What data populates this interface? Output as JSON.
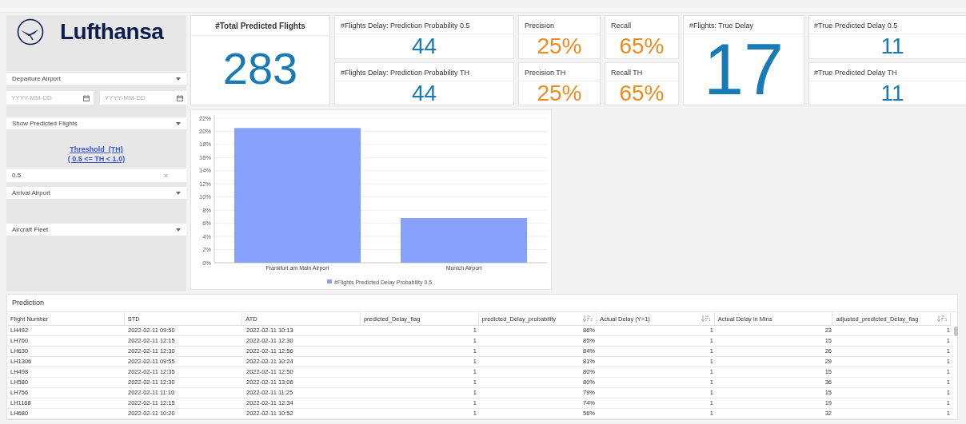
{
  "logo": {
    "text": "Lufthansa"
  },
  "filters": [
    {
      "kind": "dropdown",
      "label": "Departure Airport"
    },
    {
      "kind": "dates",
      "placeholders": [
        "YYYY-MM-DD",
        "YYYY-MM-DD"
      ]
    },
    {
      "kind": "dropdown",
      "label": "Show Predicted Flights"
    },
    {
      "kind": "link",
      "lines": [
        "Threshold  (TH)",
        "( 0.5 <= TH < 1.0)"
      ]
    },
    {
      "kind": "input",
      "value": "0.5",
      "clear_icon": "×"
    },
    {
      "kind": "dropdown",
      "label": "Arrival Airport"
    },
    {
      "kind": "dropdown",
      "label": "Aircraft Fleet"
    }
  ],
  "total": {
    "title": "#Total Predicted Flights",
    "value": "283"
  },
  "metric_columns": [
    [
      {
        "title": "#Flights Delay: Prediction Probability 0.5",
        "value": "44",
        "kind": "count"
      },
      {
        "title": "#Flights Delay: Prediction Probability TH",
        "value": "44",
        "kind": "count"
      }
    ],
    [
      {
        "title": "Precision",
        "value": "25%",
        "kind": "rate"
      },
      {
        "title": "Precision TH",
        "value": "25%",
        "kind": "rate"
      }
    ],
    [
      {
        "title": "Recall",
        "value": "65%",
        "kind": "rate"
      },
      {
        "title": "Recall TH",
        "value": "65%",
        "kind": "rate"
      }
    ],
    [
      {
        "title": "#Flights: True Delay",
        "value": "17",
        "kind": "big"
      }
    ],
    [
      {
        "title": "#True Predicted Delay 0.5",
        "value": "11",
        "kind": "count"
      },
      {
        "title": "#True Predicted Delay TH",
        "value": "11",
        "kind": "count"
      }
    ]
  ],
  "chart": {
    "chart_data": {
      "type": "bar",
      "categories": [
        "Frankfurt am Main Airport",
        "Munich Airport"
      ],
      "series": [
        {
          "name": "#Flights Predicted Delay Probability 0.5",
          "color": "#86a0fb",
          "values": [
            20.5,
            6.8
          ]
        }
      ],
      "ylim": [
        0,
        22
      ],
      "grid": true,
      "yticks": [
        {
          "value": 0,
          "label": "0%"
        },
        {
          "value": 2,
          "label": "2%"
        },
        {
          "value": 4,
          "label": "4%"
        },
        {
          "value": 6,
          "label": "6%"
        },
        {
          "value": 8,
          "label": "8%"
        },
        {
          "value": 10,
          "label": "10%"
        },
        {
          "value": 12,
          "label": "12%"
        },
        {
          "value": 14,
          "label": "14%"
        },
        {
          "value": 16,
          "label": "16%"
        },
        {
          "value": 18,
          "label": "18%"
        },
        {
          "value": 20,
          "label": "20%"
        },
        {
          "value": 22,
          "label": "22%"
        }
      ]
    }
  },
  "table": {
    "title": "Prediction",
    "columns": [
      {
        "label": "Flight Number",
        "kind": "text"
      },
      {
        "label": "STD",
        "kind": "text"
      },
      {
        "label": "ATD",
        "kind": "text"
      },
      {
        "label": "predicted_Delay_flag",
        "kind": "number"
      },
      {
        "label": "predicted_Delay_probability",
        "kind": "number",
        "sort_rank": "2"
      },
      {
        "label": "Actual Delay (Y=1)",
        "kind": "number",
        "sort_rank": "1"
      },
      {
        "label": "Actual Delay in Mins",
        "kind": "number"
      },
      {
        "label": "adjusted_predicted_Delay_flag",
        "kind": "number",
        "sort_rank": "3"
      }
    ],
    "rows": [
      [
        "LH492",
        "2022-02-11 09:50",
        "2022-02-11 10:13",
        "1",
        "86%",
        "1",
        "23",
        "1"
      ],
      [
        "LH760",
        "2022-02-11 12:15",
        "2022-02-11 12:30",
        "1",
        "85%",
        "1",
        "15",
        "1"
      ],
      [
        "LH630",
        "2022-02-11 12:30",
        "2022-02-11 12:56",
        "1",
        "84%",
        "1",
        "26",
        "1"
      ],
      [
        "LH1306",
        "2022-02-11 09:55",
        "2022-02-11 10:24",
        "1",
        "81%",
        "1",
        "29",
        "1"
      ],
      [
        "LH498",
        "2022-02-11 12:35",
        "2022-02-11 12:50",
        "1",
        "80%",
        "1",
        "15",
        "1"
      ],
      [
        "LH580",
        "2022-02-11 12:30",
        "2022-02-11 13:06",
        "1",
        "80%",
        "1",
        "36",
        "1"
      ],
      [
        "LH756",
        "2022-02-11 11:10",
        "2022-02-11 11:25",
        "1",
        "79%",
        "1",
        "15",
        "1"
      ],
      [
        "LH1168",
        "2022-02-11 12:15",
        "2022-02-11 12:34",
        "1",
        "74%",
        "1",
        "19",
        "1"
      ],
      [
        "LH680",
        "2022-02-11 10:20",
        "2022-02-11 10:52",
        "1",
        "56%",
        "1",
        "32",
        "1"
      ]
    ]
  }
}
